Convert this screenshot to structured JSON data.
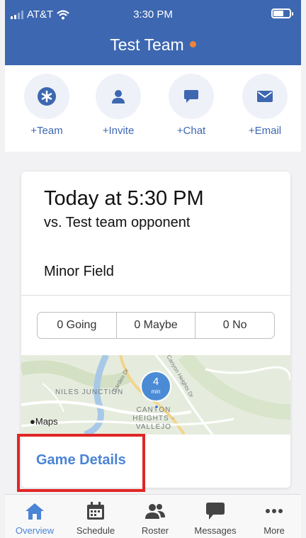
{
  "status_bar": {
    "carrier": "AT&T",
    "time": "3:30 PM",
    "battery_level": 0.65
  },
  "header": {
    "title": "Test Team"
  },
  "quick_actions": [
    {
      "label": "+Team",
      "icon": "asterisk-icon"
    },
    {
      "label": "+Invite",
      "icon": "person-icon"
    },
    {
      "label": "+Chat",
      "icon": "chat-bubble-icon"
    },
    {
      "label": "+Email",
      "icon": "envelope-icon"
    }
  ],
  "event": {
    "time": "Today at 5:30 PM",
    "opponent": "vs. Test team opponent",
    "location": "Minor Field",
    "rsvp": [
      "0 Going",
      "0 Maybe",
      "0 No"
    ],
    "map": {
      "provider": "Maps",
      "labels": [
        "NILES JUNCTION",
        "CANYON HEIGHTS - VALLEJO",
        "Garden Dr",
        "Canyon Heights Dr"
      ],
      "pin_value": "4",
      "pin_unit": "min"
    },
    "details_link": "Game Details"
  },
  "tabs": [
    {
      "label": "Overview",
      "icon": "house-icon",
      "active": true
    },
    {
      "label": "Schedule",
      "icon": "calendar-icon",
      "active": false
    },
    {
      "label": "Roster",
      "icon": "people-icon",
      "active": false
    },
    {
      "label": "Messages",
      "icon": "message-icon",
      "active": false
    },
    {
      "label": "More",
      "icon": "ellipsis-icon",
      "active": false
    }
  ],
  "colors": {
    "brand": "#3d67b0",
    "accent": "#4a84d6",
    "dot": "#f0843b",
    "highlight": "#e02626"
  }
}
